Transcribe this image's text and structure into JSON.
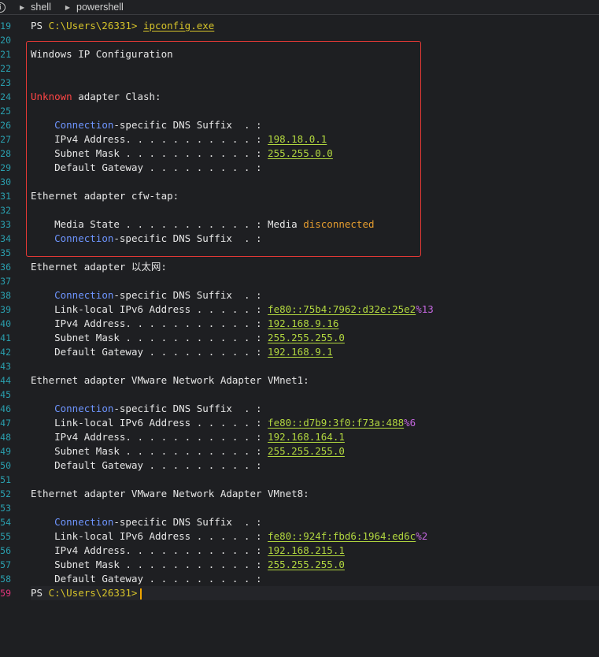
{
  "breadcrumb": [
    "shell",
    "powershell"
  ],
  "colors": {
    "line_number": "#2a9fae",
    "active_line_number": "#e0347a",
    "highlight_border": "#e53935",
    "path": "#d7c42a",
    "keyword": "#6e95ff",
    "value": "#b2d73f",
    "error": "#ff4545",
    "warn": "#e69d2f",
    "scope": "#c266dd"
  },
  "line_numbers": [
    "19",
    "20",
    "21",
    "22",
    "23",
    "24",
    "25",
    "26",
    "27",
    "28",
    "29",
    "30",
    "31",
    "32",
    "33",
    "34",
    "35",
    "36",
    "37",
    "38",
    "39",
    "40",
    "41",
    "42",
    "43",
    "44",
    "45",
    "46",
    "47",
    "48",
    "49",
    "50",
    "51",
    "52",
    "53",
    "54",
    "55",
    "56",
    "57",
    "58",
    "59"
  ],
  "prompt": {
    "ps": "PS ",
    "path": "C:\\Users\\26331>",
    "command": "ipconfig.exe"
  },
  "header": "Windows IP Configuration",
  "adapter_clash": {
    "unknown": "Unknown",
    "rest": " adapter Clash:"
  },
  "clash": {
    "dns_key1": "Connection",
    "dns_key2": "-specific DNS Suffix  . :",
    "ipv4_label": "IPv4 Address. . . . . . . . . . . : ",
    "ipv4": "198.18.0.1",
    "mask_label": "Subnet Mask . . . . . . . . . . . : ",
    "mask": "255.255.0.0",
    "gateway_label": "Default Gateway . . . . . . . . . :"
  },
  "adapter_cfw": "Ethernet adapter cfw-tap:",
  "cfw": {
    "media_label": "Media State . . . . . . . . . . . : Media ",
    "media_value": "disconnected",
    "dns_key1": "Connection",
    "dns_key2": "-specific DNS Suffix  . :"
  },
  "adapter_eth": "Ethernet adapter 以太网:",
  "eth": {
    "dns_key1": "Connection",
    "dns_key2": "-specific DNS Suffix  . :",
    "ll_label": "Link-local IPv6 Address . . . . . : ",
    "ll": "fe80::75b4:7962:d32e:25e2",
    "ll_scope": "%13",
    "ipv4_label": "IPv4 Address. . . . . . . . . . . : ",
    "ipv4": "192.168.9.16",
    "mask_label": "Subnet Mask . . . . . . . . . . . : ",
    "mask": "255.255.255.0",
    "gateway_label": "Default Gateway . . . . . . . . . : ",
    "gateway": "192.168.9.1"
  },
  "adapter_vm1": "Ethernet adapter VMware Network Adapter VMnet1:",
  "vm1": {
    "dns_key1": "Connection",
    "dns_key2": "-specific DNS Suffix  . :",
    "ll_label": "Link-local IPv6 Address . . . . . : ",
    "ll": "fe80::d7b9:3f0:f73a:488",
    "ll_scope": "%6",
    "ipv4_label": "IPv4 Address. . . . . . . . . . . : ",
    "ipv4": "192.168.164.1",
    "mask_label": "Subnet Mask . . . . . . . . . . . : ",
    "mask": "255.255.255.0",
    "gateway_label": "Default Gateway . . . . . . . . . :"
  },
  "adapter_vm8": "Ethernet adapter VMware Network Adapter VMnet8:",
  "vm8": {
    "dns_key1": "Connection",
    "dns_key2": "-specific DNS Suffix  . :",
    "ll_label": "Link-local IPv6 Address . . . . . : ",
    "ll": "fe80::924f:fbd6:1964:ed6c",
    "ll_scope": "%2",
    "ipv4_label": "IPv4 Address. . . . . . . . . . . : ",
    "ipv4": "192.168.215.1",
    "mask_label": "Subnet Mask . . . . . . . . . . . : ",
    "mask": "255.255.255.0",
    "gateway_label": "Default Gateway . . . . . . . . . :"
  },
  "prompt_end": {
    "ps": "PS ",
    "path": "C:\\Users\\26331>"
  }
}
